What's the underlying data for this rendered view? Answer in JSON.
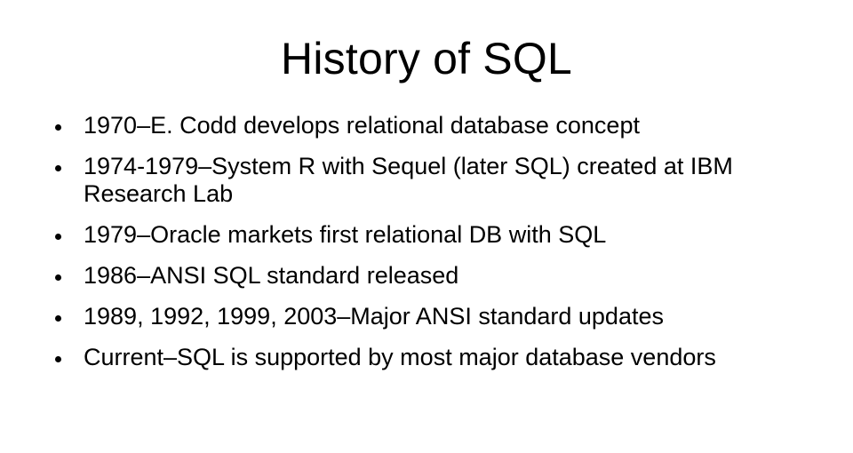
{
  "slide": {
    "title": "History of SQL",
    "bullets": [
      "1970–E. Codd develops relational database concept",
      "1974-1979–System R with Sequel (later SQL) created at IBM Research Lab",
      "1979–Oracle markets first relational DB with SQL",
      "1986–ANSI SQL standard released",
      "1989, 1992, 1999, 2003–Major ANSI standard updates",
      "Current–SQL is supported by most major database vendors"
    ]
  }
}
